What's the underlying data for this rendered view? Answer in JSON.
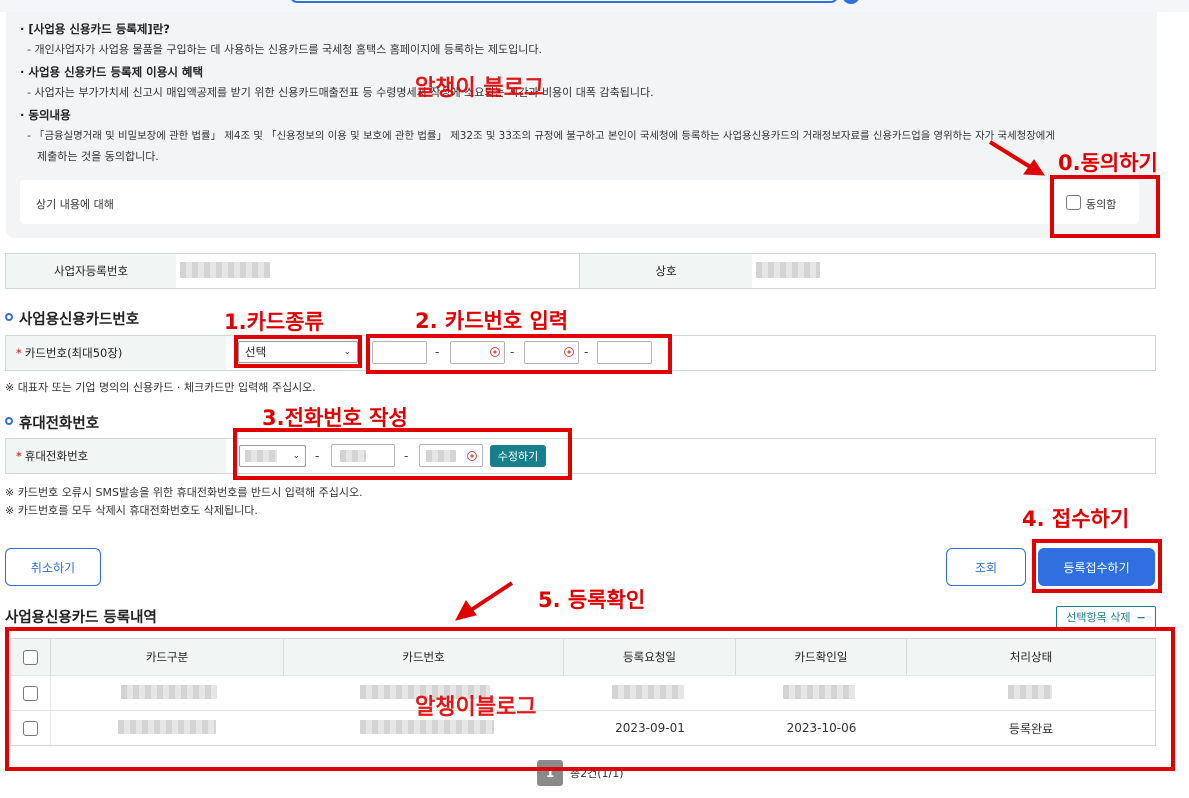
{
  "consent": {
    "q1_title": "· [사업용 신용카드 등록제]란?",
    "q1_body": "- 개인사업자가 사업용 물품을 구입하는 데 사용하는 신용카드를 국세청 홈택스 홈페이지에 등록하는 제도입니다.",
    "q2_title": "· 사업용 신용카드 등록제 이용시 혜택",
    "q2_body": "- 사업자는 부가가치세 신고시 매입액공제를 받기 위한 신용카드매출전표 등 수령명세서 작성에 소요되는 시간과 비용이 대폭 감축됩니다.",
    "q3_title": "· 동의내용",
    "q3_body_1": "- 「금융실명거래 및 비밀보장에 관한 법률」 제4조 및 「신용정보의 이용 및 보호에 관한 법률」 제32조 및 33조의 규정에 불구하고 본인이 국세청에 등록하는 사업용신용카드의   거래정보자료를 신용카드업을 영위하는 자가 국세청장에게",
    "q3_body_2": "제출하는 것을 동의합니다.",
    "row_label": "상기 내용에 대해",
    "agree_label": "동의함"
  },
  "business": {
    "reg_no_label": "사업자등록번호",
    "name_label": "상호"
  },
  "card_section": {
    "title": "사업용신용카드번호",
    "row_label": "카드번호(최대50장)",
    "select_value": "선택",
    "note": "※ 대표자 또는 기업 명의의 신용카드 · 체크카드만 입력해 주십시오.",
    "dash": "-"
  },
  "phone_section": {
    "title": "휴대전화번호",
    "row_label": "휴대전화번호",
    "edit_button": "수정하기",
    "note1": "※ 카드번호 오류시 SMS발송을 위한 휴대전화번호를 반드시 입력해 주십시오.",
    "note2": "※ 카드번호를 모두 삭제시 휴대전화번호도 삭제됩니다.",
    "dash": "-"
  },
  "actions": {
    "cancel": "취소하기",
    "search": "조회",
    "submit": "등록접수하기"
  },
  "history": {
    "title": "사업용신용카드 등록내역",
    "delete_selected": "선택항목 삭제",
    "delete_icon": "minus-icon",
    "columns": [
      "카드구분",
      "카드번호",
      "등록요청일",
      "카드확인일",
      "처리상태"
    ],
    "rows": [
      {
        "request_date": "",
        "confirm_date": "",
        "status": ""
      },
      {
        "request_date": "2023-09-01",
        "confirm_date": "2023-10-06",
        "status": "등록완료"
      }
    ],
    "pagination": {
      "current": "1",
      "summary": "총2건(1/1)"
    }
  },
  "annotations": {
    "step0": "0.동의하기",
    "step1": "1.카드종류",
    "step2": "2. 카드번호 입력",
    "step3": "3.전화번호 작성",
    "step4": "4. 접수하기",
    "step5": "5. 등록확인",
    "watermark_top": "알챙이 블로그",
    "watermark_mid": "알챙이블로그",
    "color": "#e00000"
  },
  "colors": {
    "accent": "#2f6fe0",
    "teal": "#18808a",
    "header_bg": "#f1f6f5"
  }
}
